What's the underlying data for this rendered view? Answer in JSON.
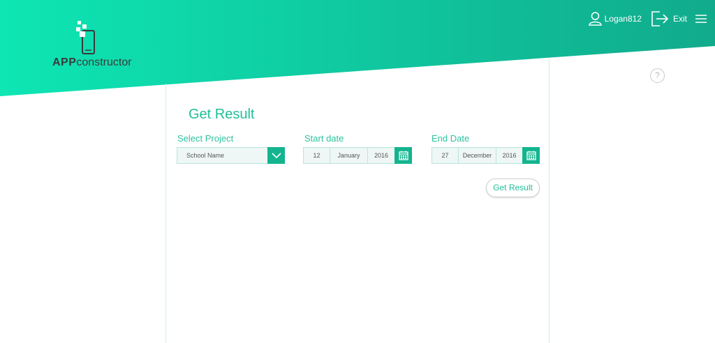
{
  "colors": {
    "accent": "#14b48f",
    "header_gradient_start": "#0ee6b4",
    "header_gradient_end": "#11ab8c",
    "text_accent": "#1fbf99"
  },
  "logo": {
    "bold": "APP",
    "rest": "constructor",
    "icon": "phone-pixels-icon"
  },
  "topnav": {
    "user_icon": "user-icon",
    "username": "Logan812",
    "exit_icon": "exit-icon",
    "exit_label": "Exit",
    "menu_icon": "hamburger-menu-icon"
  },
  "help": {
    "icon": "question-icon",
    "label": "?"
  },
  "page": {
    "title": "Get Result"
  },
  "form": {
    "project": {
      "label": "Select Project",
      "value": "School Name",
      "icon": "chevron-down-icon"
    },
    "start_date": {
      "label": "Start date",
      "day": "12",
      "month": "January",
      "year": "2016",
      "icon": "calendar-icon"
    },
    "end_date": {
      "label": "End Date",
      "day": "27",
      "month": "December",
      "year": "2016",
      "icon": "calendar-icon"
    },
    "submit_label": "Get Result"
  }
}
